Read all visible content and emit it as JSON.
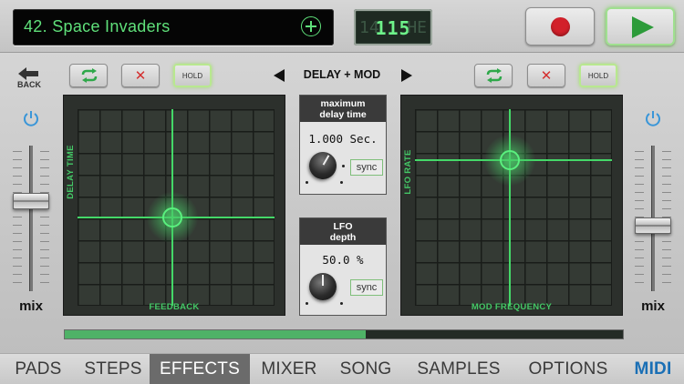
{
  "header": {
    "song_title": "42. Space Invaders",
    "tempo": "115",
    "tempo_ghost_left": "14",
    "tempo_ghost_right": "HE"
  },
  "effect_bar": {
    "back_label": "BACK",
    "effect_name": "DELAY + MOD",
    "left_hold_label": "HOLD",
    "right_hold_label": "HOLD"
  },
  "pads": {
    "left": {
      "x_label": "FEEDBACK",
      "y_label": "DELAY TIME",
      "x_value": 0.48,
      "y_value": 0.45
    },
    "right": {
      "x_label": "MOD FREQUENCY",
      "y_label": "LFO RATE",
      "x_value": 0.48,
      "y_value": 0.74
    }
  },
  "params": {
    "delay": {
      "title_line1": "maximum",
      "title_line2": "delay time",
      "value": "1.000 Sec.",
      "sync_label": "sync"
    },
    "lfo": {
      "title_line1": "LFO",
      "title_line2": "depth",
      "value": "50.0 %",
      "sync_label": "sync"
    }
  },
  "mix": {
    "left_label": "mix",
    "right_label": "mix",
    "left_level": 0.62,
    "right_level": 0.45
  },
  "progress": {
    "fraction": 0.54
  },
  "tabs": {
    "pads": "PADS",
    "steps": "STEPS",
    "effects": "EFFECTS",
    "mixer": "MIXER",
    "song": "SONG",
    "samples": "SAMPLES",
    "options": "OPTIONS",
    "midi": "MIDI"
  },
  "colors": {
    "accent_green": "#44d868",
    "record_red": "#d2202a",
    "active_tab": "#6b6b6b",
    "midi_blue": "#1a6fb5"
  }
}
